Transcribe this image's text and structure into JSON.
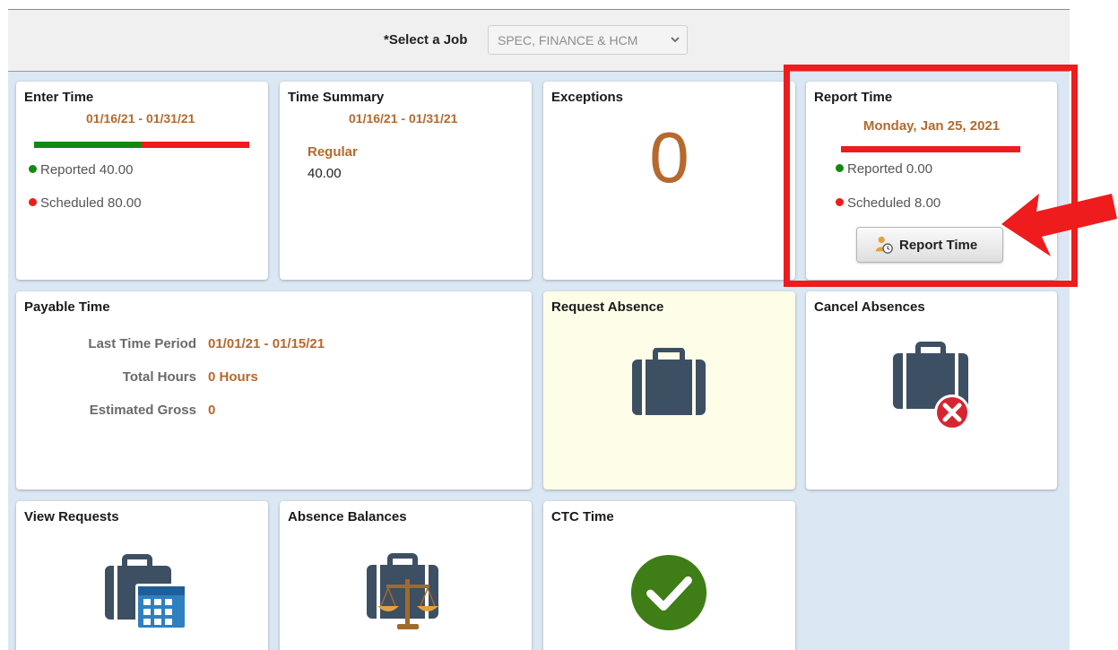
{
  "job_selector": {
    "label": "*Select a Job",
    "value": "SPEC, FINANCE & HCM"
  },
  "tiles": {
    "enter_time": {
      "title": "Enter Time",
      "date_range": "01/16/21 - 01/31/21",
      "reported_fraction": 0.5,
      "reported": "Reported 40.00",
      "scheduled": "Scheduled 80.00"
    },
    "time_summary": {
      "title": "Time Summary",
      "date_range": "01/16/21 - 01/31/21",
      "category": "Regular",
      "hours": "40.00"
    },
    "exceptions": {
      "title": "Exceptions",
      "count": "0"
    },
    "report_time": {
      "title": "Report Time",
      "date": "Monday, Jan 25, 2021",
      "reported_fraction": 0,
      "reported": "Reported 0.00",
      "scheduled": "Scheduled 8.00",
      "button_label": "Report Time"
    },
    "payable_time": {
      "title": "Payable Time",
      "rows": [
        {
          "label": "Last Time Period",
          "value": "01/01/21 - 01/15/21"
        },
        {
          "label": "Total Hours",
          "value": "0 Hours"
        },
        {
          "label": "Estimated Gross",
          "value": "0"
        }
      ]
    },
    "request_absence": {
      "title": "Request Absence"
    },
    "cancel_absences": {
      "title": "Cancel Absences"
    },
    "view_requests": {
      "title": "View Requests"
    },
    "absence_balances": {
      "title": "Absence Balances"
    },
    "ctc_time": {
      "title": "CTC Time"
    }
  },
  "colors": {
    "accent_orange": "#b5692e",
    "reported_green": "#128a12",
    "scheduled_red": "#ee1c1c",
    "icon_slate": "#3d4f63",
    "request_absence_bg": "#fdfde8",
    "check_green": "#3f7d16",
    "highlight_red": "#ee1c1c"
  },
  "icons": {
    "job_select": "chevron-down-icon",
    "report_time_button": "user-clock-icon",
    "request_absence": "briefcase-icon",
    "cancel_absences": "briefcase-cancel-icon",
    "view_requests": "briefcase-calendar-icon",
    "absence_balances": "briefcase-scale-icon",
    "ctc_time": "check-circle-icon"
  }
}
